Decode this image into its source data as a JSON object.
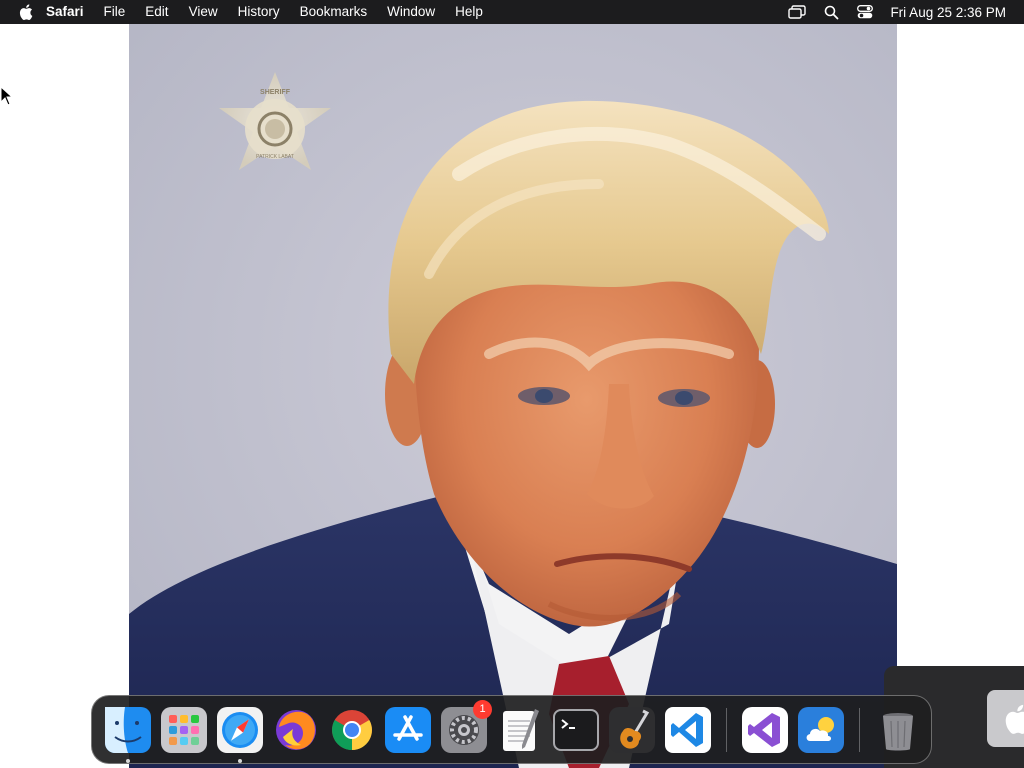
{
  "menubar": {
    "app_name": "Safari",
    "items": [
      "File",
      "Edit",
      "View",
      "History",
      "Bookmarks",
      "Window",
      "Help"
    ],
    "icons": [
      "apple-logo-icon",
      "screen-mirroring-icon",
      "spotlight-search-icon",
      "control-center-icon"
    ],
    "clock": "Fri Aug 25  2:36 PM"
  },
  "photo": {
    "badge_text": [
      "SHERIFF",
      "FULTON COUNTY",
      "SHERIFF'S OFFICE",
      "PATRICK LABAT"
    ]
  },
  "dock": {
    "apps": [
      {
        "name": "Finder",
        "icon": "finder-icon",
        "running": true
      },
      {
        "name": "Launchpad",
        "icon": "launchpad-icon",
        "running": false
      },
      {
        "name": "Safari",
        "icon": "safari-icon",
        "running": true
      },
      {
        "name": "Firefox",
        "icon": "firefox-icon",
        "running": false
      },
      {
        "name": "Google Chrome",
        "icon": "chrome-icon",
        "running": false
      },
      {
        "name": "App Store",
        "icon": "app-store-icon",
        "running": false
      },
      {
        "name": "System Settings",
        "icon": "system-settings-icon",
        "running": false,
        "badge": "1"
      },
      {
        "name": "TextEdit",
        "icon": "textedit-icon",
        "running": false
      },
      {
        "name": "Terminal",
        "icon": "terminal-icon",
        "running": false
      },
      {
        "name": "GarageBand",
        "icon": "garageband-icon",
        "running": false
      },
      {
        "name": "Visual Studio Code",
        "icon": "vscode-icon",
        "running": false
      },
      {
        "name": "Visual Studio",
        "icon": "visual-studio-icon",
        "running": false
      },
      {
        "name": "Weather",
        "icon": "weather-icon",
        "running": false
      },
      {
        "name": "Trash",
        "icon": "trash-icon",
        "running": false
      }
    ],
    "colors": {
      "background": "#1e1e20",
      "badge": "#ff3b30"
    }
  }
}
